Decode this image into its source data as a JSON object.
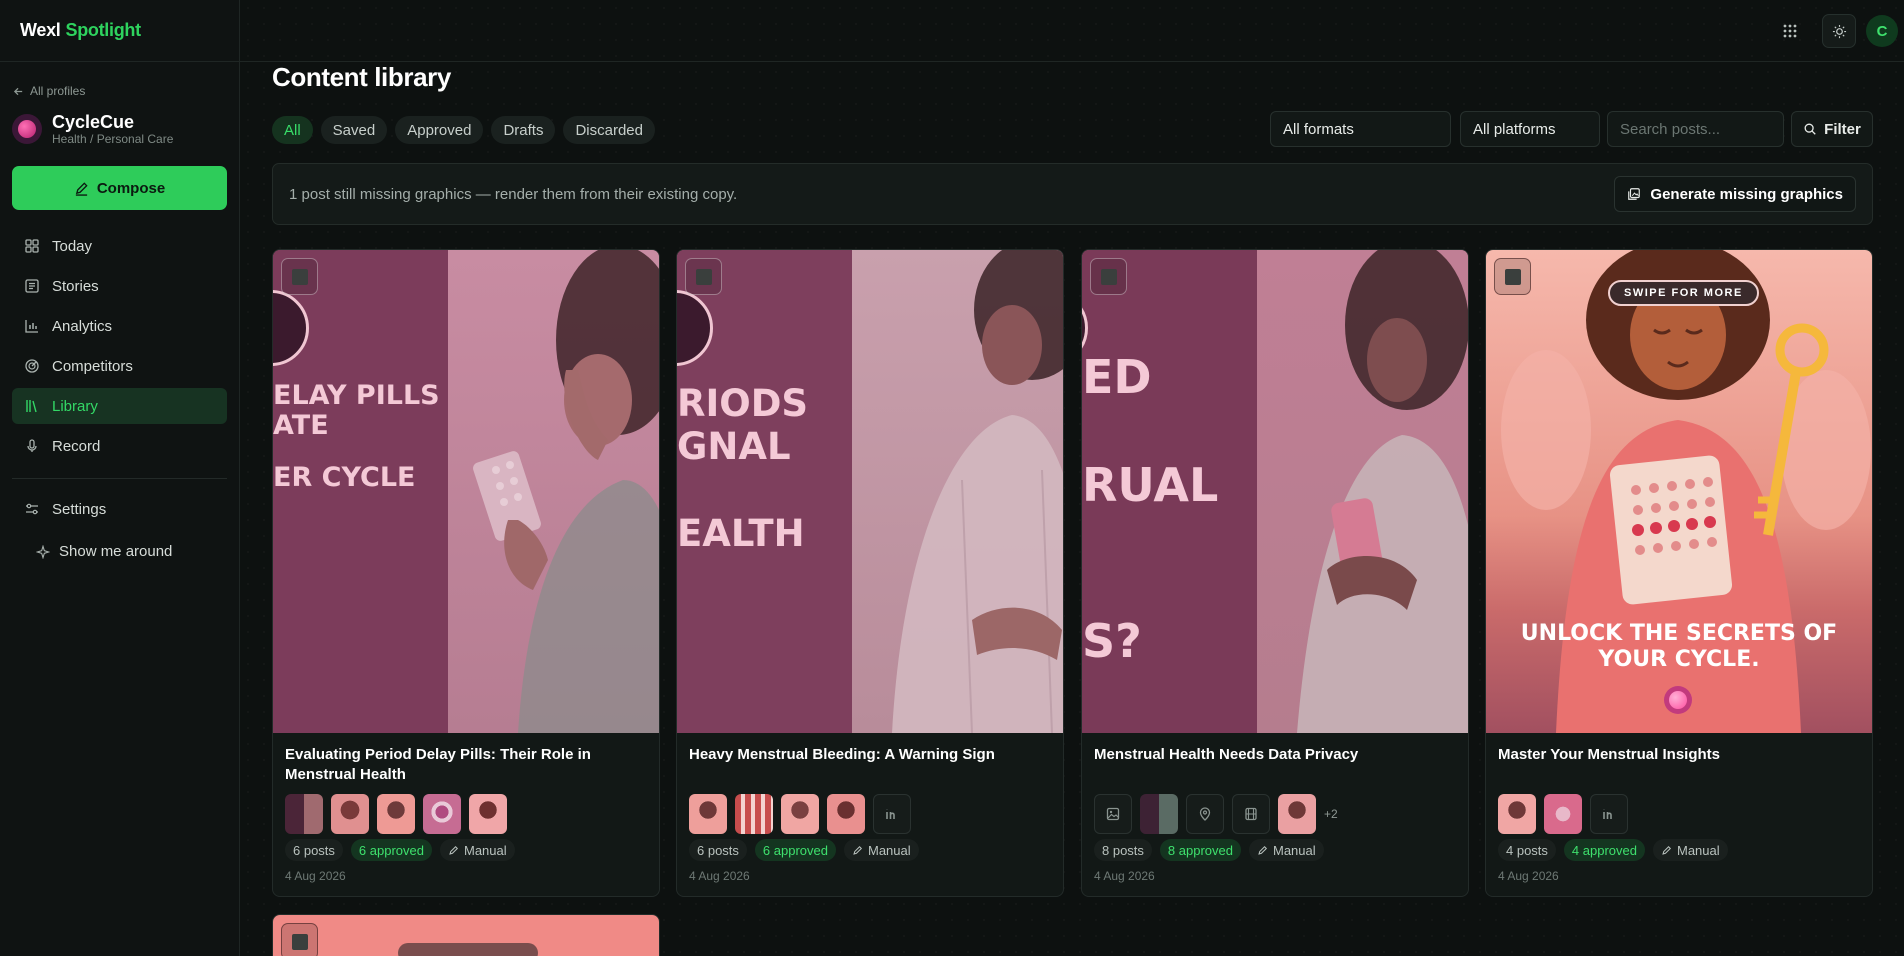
{
  "brand": {
    "part1": "Wexl",
    "part2": "Spotlight"
  },
  "sidebar": {
    "back_label": "All profiles",
    "profile": {
      "name": "CycleCue",
      "category": "Health / Personal Care"
    },
    "compose_label": "Compose",
    "nav": [
      {
        "label": "Today",
        "icon": "grid-icon"
      },
      {
        "label": "Stories",
        "icon": "newspaper-icon"
      },
      {
        "label": "Analytics",
        "icon": "bar-chart-icon"
      },
      {
        "label": "Competitors",
        "icon": "radar-icon"
      },
      {
        "label": "Library",
        "icon": "library-icon",
        "active": true
      },
      {
        "label": "Record",
        "icon": "microphone-icon"
      }
    ],
    "settings_label": "Settings",
    "tour_label": "Show me around"
  },
  "topbar": {
    "user_initial": "C"
  },
  "main": {
    "title": "Content library",
    "tabs": [
      "All",
      "Saved",
      "Approved",
      "Drafts",
      "Discarded"
    ],
    "active_tab": "All",
    "formats_select": "All formats",
    "platforms_select": "All platforms",
    "search_placeholder": "Search posts...",
    "filter_label": "Filter",
    "banner_text": "1 post still missing graphics — render them from their existing copy.",
    "generate_label": "Generate missing graphics"
  },
  "cards": [
    {
      "title": "Evaluating Period Delay Pills: Their Role in Menstrual Health",
      "poster_lines": [
        "ELAY PILLS",
        "ATE",
        "ER CYCLE"
      ],
      "posts": "6 posts",
      "approved": "6 approved",
      "mode": "Manual",
      "date": "4 Aug 2026"
    },
    {
      "title": "Heavy Menstrual Bleeding: A Warning Sign",
      "poster_lines": [
        "RIODS",
        "GNAL",
        "EALTH"
      ],
      "posts": "6 posts",
      "approved": "6 approved",
      "mode": "Manual",
      "date": "4 Aug 2026"
    },
    {
      "title": "Menstrual Health Needs Data Privacy",
      "poster_lines": [
        "ED",
        "RUAL",
        "S?"
      ],
      "posts": "8 posts",
      "approved": "8 approved",
      "mode": "Manual",
      "date": "4 Aug 2026",
      "more_count": "+2"
    },
    {
      "title": "Master Your Menstrual Insights",
      "poster_swipe": "SWIPE FOR MORE",
      "poster_lines": [
        "UNLOCK THE SECRETS OF",
        "YOUR CYCLE."
      ],
      "posts": "4 posts",
      "approved": "4 approved",
      "mode": "Manual",
      "date": "4 Aug 2026"
    }
  ],
  "colors": {
    "accent": "#2ecc5a",
    "background": "#0d1110",
    "poster_pink": "#b4566f"
  }
}
